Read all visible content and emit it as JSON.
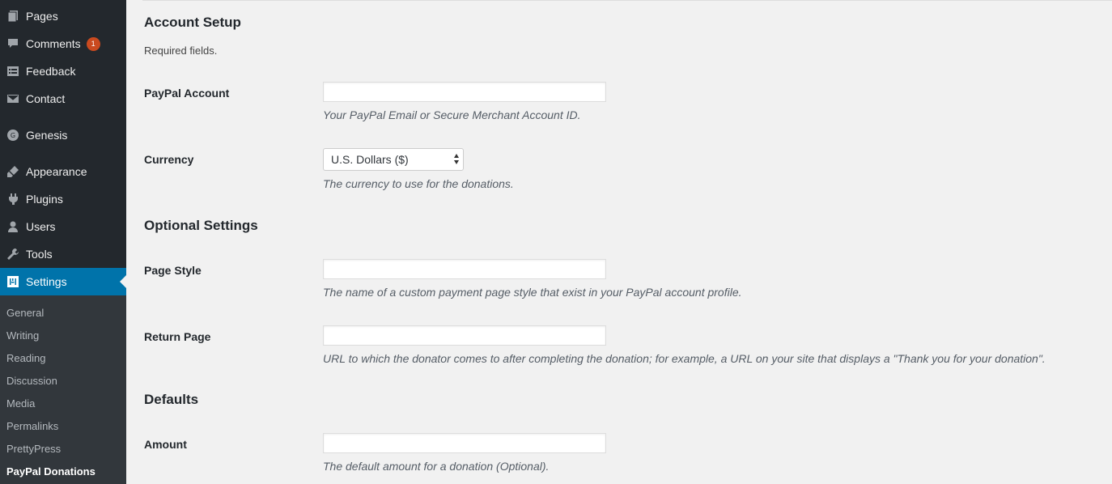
{
  "sidebar": {
    "items": [
      {
        "label": "Pages",
        "icon": "pages-icon"
      },
      {
        "label": "Comments",
        "icon": "comments-icon",
        "badge": "1"
      },
      {
        "label": "Feedback",
        "icon": "feedback-icon"
      },
      {
        "label": "Contact",
        "icon": "contact-icon"
      },
      {
        "label": "Genesis",
        "icon": "genesis-icon"
      },
      {
        "label": "Appearance",
        "icon": "appearance-icon"
      },
      {
        "label": "Plugins",
        "icon": "plugins-icon"
      },
      {
        "label": "Users",
        "icon": "users-icon"
      },
      {
        "label": "Tools",
        "icon": "tools-icon"
      },
      {
        "label": "Settings",
        "icon": "settings-icon",
        "active": true
      }
    ],
    "submenu": [
      "General",
      "Writing",
      "Reading",
      "Discussion",
      "Media",
      "Permalinks",
      "PrettyPress",
      "PayPal Donations"
    ],
    "current_submenu": "PayPal Donations"
  },
  "main": {
    "account_setup": {
      "heading": "Account Setup",
      "required_note": "Required fields.",
      "paypal_account": {
        "label": "PayPal Account",
        "value": "",
        "description": "Your PayPal Email or Secure Merchant Account ID."
      },
      "currency": {
        "label": "Currency",
        "selected": "U.S. Dollars ($)",
        "description": "The currency to use for the donations."
      }
    },
    "optional_settings": {
      "heading": "Optional Settings",
      "page_style": {
        "label": "Page Style",
        "value": "",
        "description": "The name of a custom payment page style that exist in your PayPal account profile."
      },
      "return_page": {
        "label": "Return Page",
        "value": "",
        "description": "URL to which the donator comes to after completing the donation; for example, a URL on your site that displays a \"Thank you for your donation\"."
      }
    },
    "defaults": {
      "heading": "Defaults",
      "amount": {
        "label": "Amount",
        "value": "",
        "description": "The default amount for a donation (Optional)."
      }
    }
  },
  "colors": {
    "sidebar_bg": "#23282d",
    "submenu_bg": "#32373c",
    "active_bg": "#0073aa",
    "badge_bg": "#ca4a1f",
    "page_bg": "#f1f1f1"
  }
}
